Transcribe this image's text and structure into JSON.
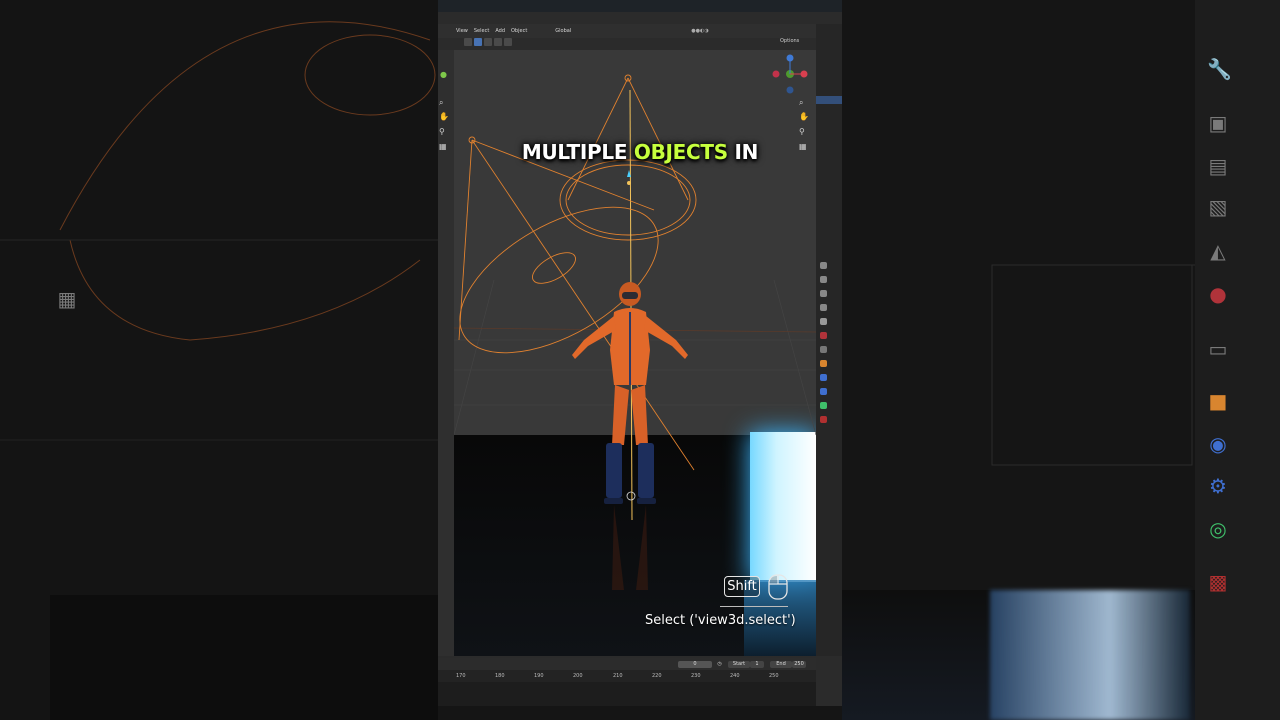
{
  "header": {
    "menu": [
      "View",
      "Select",
      "Add",
      "Object"
    ],
    "orientation": "Global",
    "options_label": "Options"
  },
  "caption": {
    "part1": "MULTIPLE ",
    "highlight": "OBJECTS",
    "part2": " IN"
  },
  "keystroke": {
    "key": "Shift",
    "operator": "Select ('view3d.select')"
  },
  "timeline": {
    "current_frame": "0",
    "start_label": "Start",
    "start_value": "1",
    "end_label": "End",
    "end_value": "250",
    "ticks": [
      "170",
      "180",
      "190",
      "200",
      "210",
      "220",
      "230",
      "240",
      "250"
    ]
  },
  "colors": {
    "caption_highlight": "#c6ff3d",
    "selection_orange": "#e0812f",
    "light_cyan": "#77d8ff",
    "active_blue": "#4772b3"
  }
}
